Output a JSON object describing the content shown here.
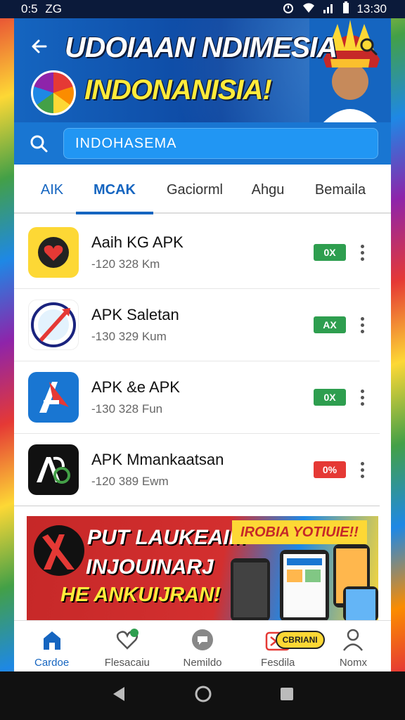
{
  "status_bar": {
    "time_left": "0:5",
    "carrier": "ZG",
    "time_right": "13:30"
  },
  "hero": {
    "title_line1": "UDOIAAN NDIMESIA",
    "title_line2": "INDONANISIA!"
  },
  "search": {
    "value": "INDOHASEMA"
  },
  "tabs": [
    {
      "label": "AIK"
    },
    {
      "label": "MCAK"
    },
    {
      "label": "Gaciorml"
    },
    {
      "label": "Ahgu"
    },
    {
      "label": "Bemaila"
    }
  ],
  "apps": [
    {
      "name": "Aaih KG APK",
      "meta": "-120 328 Km",
      "badge": "0X",
      "badge_color": "#2e9e4f",
      "icon": "heart-icon"
    },
    {
      "name": "APK Saletan",
      "meta": "-130 329 Kum",
      "badge": "AX",
      "badge_color": "#2e9e4f",
      "icon": "arrow-shield-icon"
    },
    {
      "name": "APK &e APK",
      "meta": "-130 328 Fun",
      "badge": "0X",
      "badge_color": "#2e9e4f",
      "icon": "letter-a-icon"
    },
    {
      "name": "APK Mmankaatsan",
      "meta": "-120 389 Ewm",
      "badge": "0%",
      "badge_color": "#e53935",
      "icon": "ap-logo-icon"
    }
  ],
  "banner": {
    "line1": "PUT LAUKEAIM",
    "line2": "INJOUINARJ",
    "line3": "HE ANKUIJRAN!",
    "tag": "IROBIA YOTIUIE!!"
  },
  "bottom_nav": [
    {
      "label": "Cardoe",
      "icon": "home-icon"
    },
    {
      "label": "Flesacaiu",
      "icon": "heart-icon"
    },
    {
      "label": "Nemildo",
      "icon": "chat-icon"
    },
    {
      "label": "Fesdila",
      "icon": "gift-icon",
      "pill": "CBRIANI"
    },
    {
      "label": "Nomx",
      "icon": "person-icon"
    }
  ],
  "colors": {
    "primary": "#1565c0",
    "accent_yellow": "#fdd835",
    "green": "#2e9e4f",
    "red": "#e53935"
  }
}
